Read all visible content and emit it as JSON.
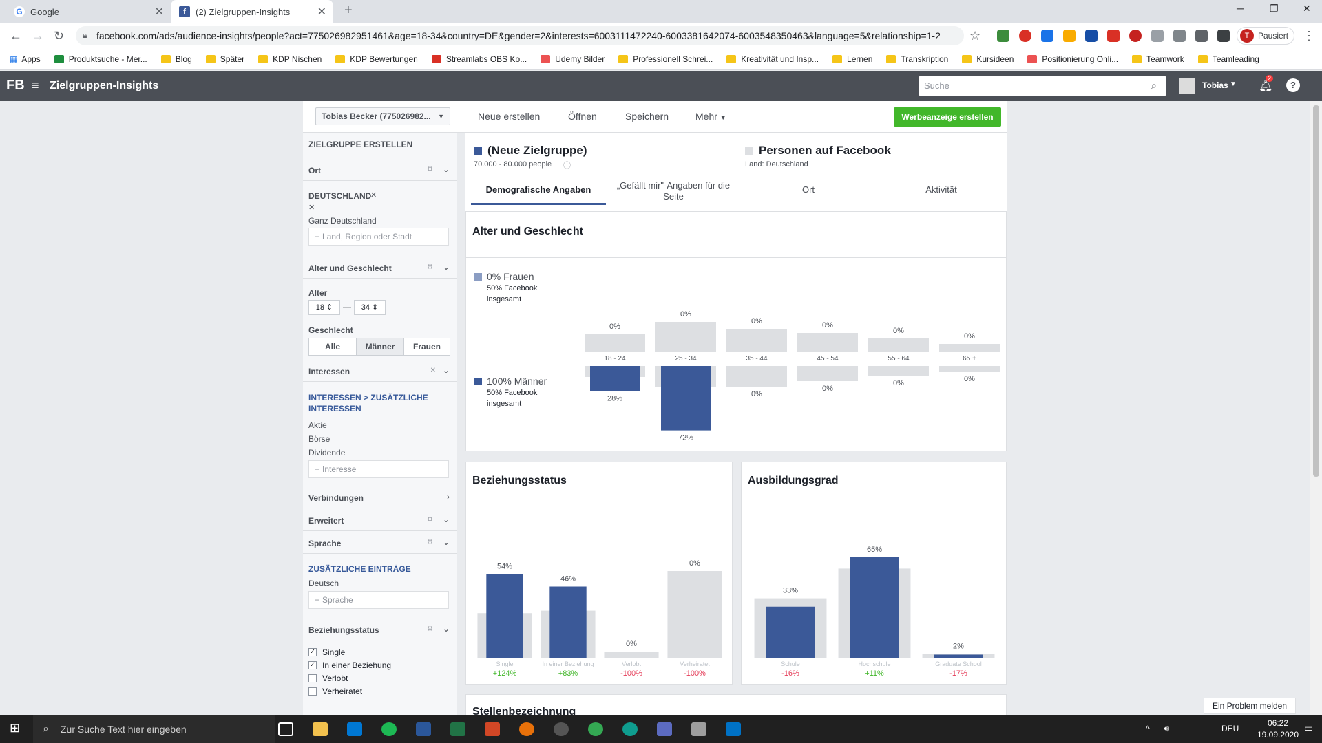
{
  "browser": {
    "tabs": [
      {
        "title": "Google"
      },
      {
        "title": "(2) Zielgruppen-Insights"
      }
    ],
    "url": "facebook.com/ads/audience-insights/people?act=775026982951461&age=18-34&country=DE&gender=2&interests=6003111472240-6003381642074-6003548350463&language=5&relationship=1-2",
    "profile_label": "Pausiert",
    "bookmarks": [
      "Apps",
      "Produktsuche - Mer...",
      "Blog",
      "Später",
      "KDP Nischen",
      "KDP Bewertungen",
      "Streamlabs OBS Ko...",
      "Udemy Bilder",
      "Professionell Schrei...",
      "Kreativität und Insp...",
      "Lernen",
      "Transkription",
      "Kursideen",
      "Positionierung Onli...",
      "Teamwork",
      "Teamleading"
    ]
  },
  "fb": {
    "logo": "FB",
    "app_title": "Zielgruppen-Insights",
    "search_placeholder": "Suche",
    "user": "Tobias",
    "notifications": "2"
  },
  "topbar": {
    "account": "Tobias Becker (775026982...",
    "new": "Neue erstellen",
    "open": "Öffnen",
    "save": "Speichern",
    "more": "Mehr",
    "create_ad": "Werbeanzeige erstellen"
  },
  "sidebar": {
    "heading": "ZIELGRUPPE ERSTELLEN",
    "location": {
      "label": "Ort",
      "country": "DEUTSCHLAND",
      "sub": "Ganz Deutschland",
      "placeholder": "Land, Region oder Stadt"
    },
    "age_gender": {
      "label": "Alter und Geschlecht",
      "age_label": "Alter",
      "age_from": "18",
      "age_dash": "—",
      "age_to": "34",
      "gender_label": "Geschlecht",
      "gender_options": [
        "Alle",
        "Männer",
        "Frauen"
      ]
    },
    "interests": {
      "label": "Interessen",
      "breadcrumb": "INTERESSEN > ZUSÄTZLICHE INTERESSEN",
      "items": [
        "Aktie",
        "Börse",
        "Dividende"
      ],
      "placeholder": "Interesse"
    },
    "connections": "Verbindungen",
    "advanced": "Erweitert",
    "language": {
      "label": "Sprache",
      "sub_heading": "ZUSÄTZLICHE EINTRÄGE",
      "value": "Deutsch",
      "placeholder": "Sprache"
    },
    "relationship": {
      "label": "Beziehungsstatus",
      "options": [
        {
          "label": "Single",
          "checked": true
        },
        {
          "label": "In einer Beziehung",
          "checked": true
        },
        {
          "label": "Verlobt",
          "checked": false
        },
        {
          "label": "Verheiratet",
          "checked": false
        }
      ]
    }
  },
  "audience": {
    "name": "(Neue Zielgruppe)",
    "size": "70.000 - 80.000 people",
    "compare_name": "Personen auf Facebook",
    "compare_sub": "Land: Deutschland",
    "tabs": [
      "Demografische Angaben",
      "„Gefällt mir\"-Angaben für die Seite",
      "Ort",
      "Aktivität"
    ]
  },
  "sections": {
    "age_gender": "Alter und Geschlecht",
    "relationship": "Beziehungsstatus",
    "education": "Ausbildungsgrad",
    "job": "Stellenbezeichnung"
  },
  "legend": {
    "women_title": "0% Frauen",
    "women_sub": "50% Facebook insgesamt",
    "men_title": "100% Männer",
    "men_sub": "50% Facebook insgesamt"
  },
  "chart_data": [
    {
      "type": "bar",
      "title": "Alter und Geschlecht",
      "categories": [
        "18 - 24",
        "25 - 34",
        "35 - 44",
        "45 - 54",
        "55 - 64",
        "65 +"
      ],
      "series": [
        {
          "name": "Frauen",
          "values": [
            0,
            0,
            0,
            0,
            0,
            0
          ]
        },
        {
          "name": "Männer",
          "values": [
            28,
            72,
            0,
            0,
            0,
            0
          ]
        }
      ],
      "value_labels_women": [
        "0%",
        "0%",
        "0%",
        "0%",
        "0%",
        "0%"
      ],
      "value_labels_men": [
        "28%",
        "72%",
        "0%",
        "0%",
        "0%",
        "0%"
      ]
    },
    {
      "type": "bar",
      "title": "Beziehungsstatus",
      "categories": [
        "Single",
        "In einer Beziehung",
        "Verlobt",
        "Verheiratet"
      ],
      "values": [
        54,
        46,
        0,
        0
      ],
      "labels": [
        "54%",
        "46%",
        "0%",
        "0%"
      ],
      "comparison": [
        "+124%",
        "+83%",
        "-100%",
        "-100%"
      ]
    },
    {
      "type": "bar",
      "title": "Ausbildungsgrad",
      "categories": [
        "Schule",
        "Hochschule",
        "Graduate School"
      ],
      "values": [
        33,
        65,
        2
      ],
      "labels": [
        "33%",
        "65%",
        "2%"
      ],
      "comparison": [
        "-16%",
        "+11%",
        "-17%"
      ]
    }
  ],
  "colors": {
    "audience": "#3b5998",
    "baseline": "#dddfe2",
    "positive": "#42b72a",
    "negative": "#e53e5a",
    "link": "#365899"
  },
  "taskbar": {
    "search": "Zur Suche Text hier eingeben",
    "lang": "DEU",
    "time": "06:22",
    "date": "19.09.2020"
  },
  "problem": "Ein Problem melden"
}
